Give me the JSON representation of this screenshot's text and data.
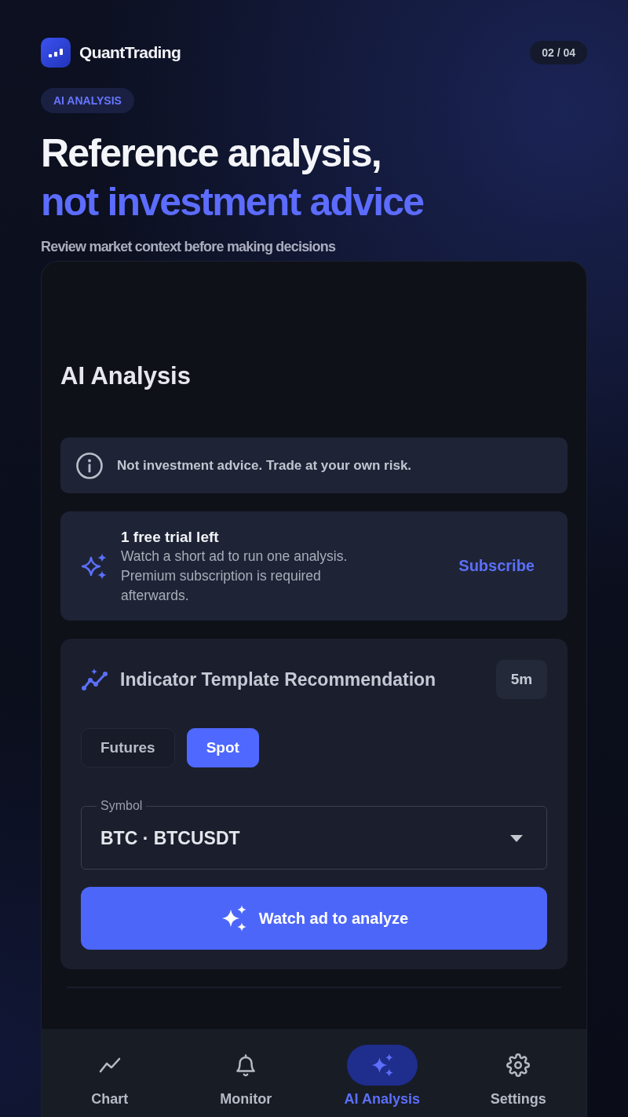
{
  "app": {
    "name": "QuantTrading",
    "page_counter": "02 / 04"
  },
  "hero": {
    "badge": "AI ANALYSIS",
    "headline": "Reference analysis,",
    "headline_accent": "not investment advice",
    "subtitle": "Review market context before making decisions"
  },
  "screen": {
    "title": "AI Analysis",
    "notice": "Not investment advice. Trade at your own risk.",
    "trial": {
      "title": "1 free trial left",
      "description": "Watch a short ad to run one analysis. Premium subscription is required afterwards.",
      "action": "Subscribe"
    },
    "recommendation": {
      "title": "Indicator Template Recommendation",
      "interval": "5m",
      "markets": [
        {
          "label": "Futures",
          "selected": false
        },
        {
          "label": "Spot",
          "selected": true
        }
      ],
      "symbol": {
        "label": "Symbol",
        "value": "BTC · BTCUSDT"
      },
      "action": "Watch ad to analyze"
    }
  },
  "bottom_nav": [
    {
      "label": "Chart",
      "selected": false
    },
    {
      "label": "Monitor",
      "selected": false
    },
    {
      "label": "AI Analysis",
      "selected": true
    },
    {
      "label": "Settings",
      "selected": false
    }
  ]
}
